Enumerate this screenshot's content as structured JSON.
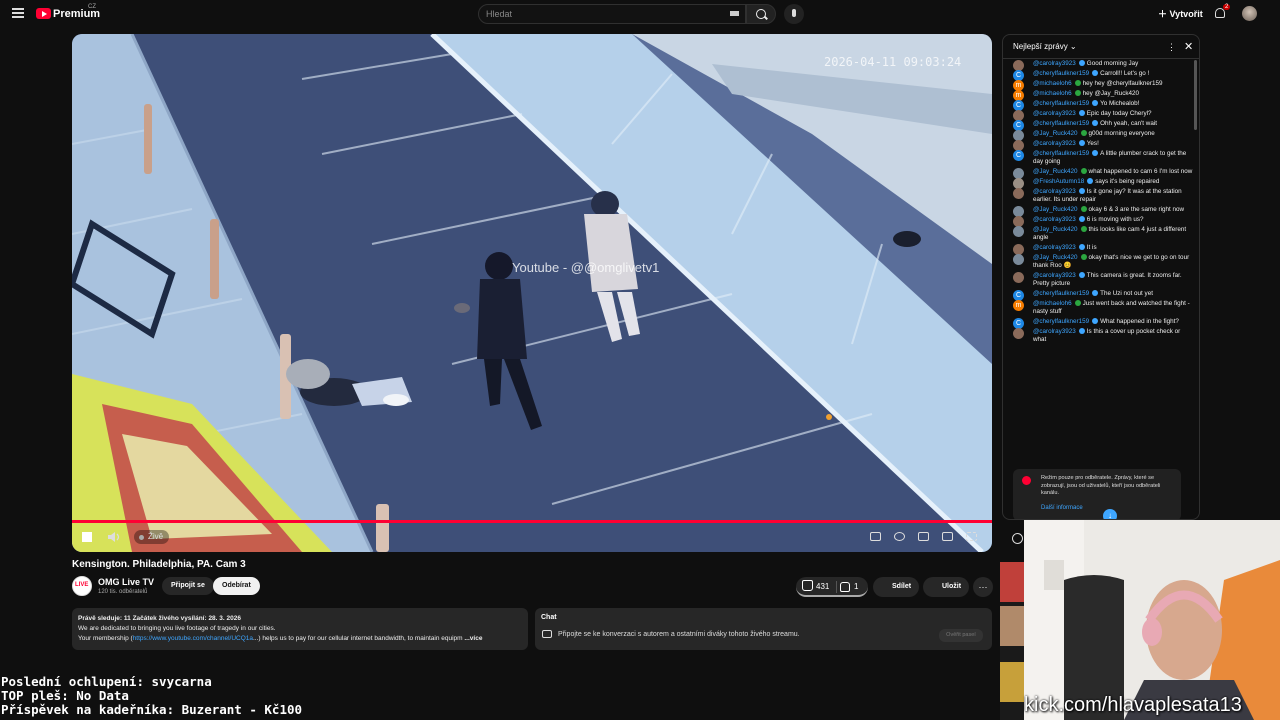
{
  "header": {
    "brand": "Premium",
    "brand_region": "CZ",
    "search_placeholder": "Hledat",
    "create_label": "Vytvořit",
    "notification_count": "2"
  },
  "player": {
    "camera_timestamp": "2026-04-11 09:03:24",
    "watermark": "Youtube - @@omglivetv1",
    "live_label": "Živě",
    "progress_fraction": 1.0
  },
  "video": {
    "title": "Kensington. Philadelphia, PA. Cam 3",
    "channel": "OMG Live TV",
    "subscribers": "120 tis. odběratelů",
    "join_label": "Připojit se",
    "subscribe_label": "Odebírat",
    "likes": "431",
    "dislikes": "1",
    "share_label": "Sdílet",
    "save_label": "Uložit",
    "more_label": "···"
  },
  "description": {
    "line1_bold": "Právě sleduje: 11",
    "line1_rest": " Začátek živého vysílání: 28. 3. 2026",
    "line2": "We are dedicated to bringing you live footage of tragedy in our cities.",
    "line3_prefix": "Your membership (",
    "line3_link": "https://www.youtube.com/channel/UCQ1a",
    "line3_suffix": "...) helps us to pay for our cellular internet bandwidth, to maintain equipm",
    "more_label": "...více"
  },
  "chat_panel": {
    "title": "Chat",
    "text": "Připojte se ke konverzaci s autorem a ostatními diváky tohoto živého streamu.",
    "button": "Ověřit paseí"
  },
  "live_chat": {
    "mode_label": "Nejlepší zprávy",
    "messages": [
      {
        "author": "@carolray3923",
        "text": "Good morning Jay",
        "color": "#8a6a5a"
      },
      {
        "author": "@cherylfaulkner159",
        "text": "Carroll!! Let's go !",
        "color": "#1e88e5",
        "letter": "C"
      },
      {
        "author": "@michaeloh6",
        "text": "hey hey @cherylfaulkner159",
        "color": "#f57c00",
        "letter": "m"
      },
      {
        "author": "@michaeloh6",
        "text": "hey @Jay_Ruck420",
        "color": "#f57c00",
        "letter": "m"
      },
      {
        "author": "@cherylfaulkner159",
        "text": "Yo Michealob!",
        "color": "#1e88e5",
        "letter": "C"
      },
      {
        "author": "@carolray3923",
        "text": "Epic day today Cheryl?",
        "color": "#8a6a5a"
      },
      {
        "author": "@cherylfaulkner159",
        "text": "Ohh yeah, can't wait",
        "color": "#1e88e5",
        "letter": "C"
      },
      {
        "author": "@Jay_Ruck420",
        "text": "g00d morning everyone",
        "color": "#7a8a9a"
      },
      {
        "author": "@carolray3923",
        "text": "Yes!",
        "color": "#8a6a5a"
      },
      {
        "author": "@cherylfaulkner159",
        "text": "A little plumber crack to get the day going",
        "color": "#1e88e5",
        "letter": "C"
      },
      {
        "author": "@Jay_Ruck420",
        "text": "what happened to cam 6 I'm lost now",
        "color": "#7a8a9a"
      },
      {
        "author": "@FreshAutumn18",
        "text": "says it's being repaired",
        "color": "#9a8f85"
      },
      {
        "author": "@carolray3923",
        "text": "Is it gone jay? It was at the station earlier. Its under repair",
        "color": "#8a6a5a"
      },
      {
        "author": "@Jay_Ruck420",
        "text": "okay 6 & 3 are the same right now",
        "color": "#7a8a9a"
      },
      {
        "author": "@carolray3923",
        "text": "6 is moving with us?",
        "color": "#8a6a5a"
      },
      {
        "author": "@Jay_Ruck420",
        "text": "this looks like cam 4 just a different angle",
        "color": "#7a8a9a"
      },
      {
        "author": "@carolray3923",
        "text": "It is",
        "color": "#8a6a5a"
      },
      {
        "author": "@Jay_Ruck420",
        "text": "okay that's nice we get to go on tour thank Roo 😊",
        "color": "#7a8a9a"
      },
      {
        "author": "@carolray3923",
        "text": "This camera is great. It zooms far. Pretty picture",
        "color": "#8a6a5a"
      },
      {
        "author": "@cherylfaulkner159",
        "text": "The Uzi not out yet",
        "color": "#1e88e5",
        "letter": "C"
      },
      {
        "author": "@michaeloh6",
        "text": "Just went back and watched the fight - nasty stuff",
        "color": "#f57c00",
        "letter": "m"
      },
      {
        "author": "@cherylfaulkner159",
        "text": "What happened in the fight?",
        "color": "#1e88e5",
        "letter": "C"
      },
      {
        "author": "@carolray3923",
        "text": "Is this a cover up pocket check or what",
        "color": "#8a6a5a"
      }
    ],
    "subscriber_note": "Režim pouze pro odběratele. Zprávy, které se zobrazují, jsou od uživatelů, kteří jsou odběrateli kanálu.",
    "more_info": "Další informace"
  },
  "overlay": {
    "line1": "Poslední ochlupení: svycarna",
    "line2": "TOP pleš: No Data",
    "line3": "Příspěvek na kadeřníka: Buzerant - Kč100",
    "kick": "kick.com/hlavaplesata13"
  },
  "colors": {
    "accent": "#ff0033",
    "link": "#3ea6ff",
    "background": "#0f0f0f"
  }
}
